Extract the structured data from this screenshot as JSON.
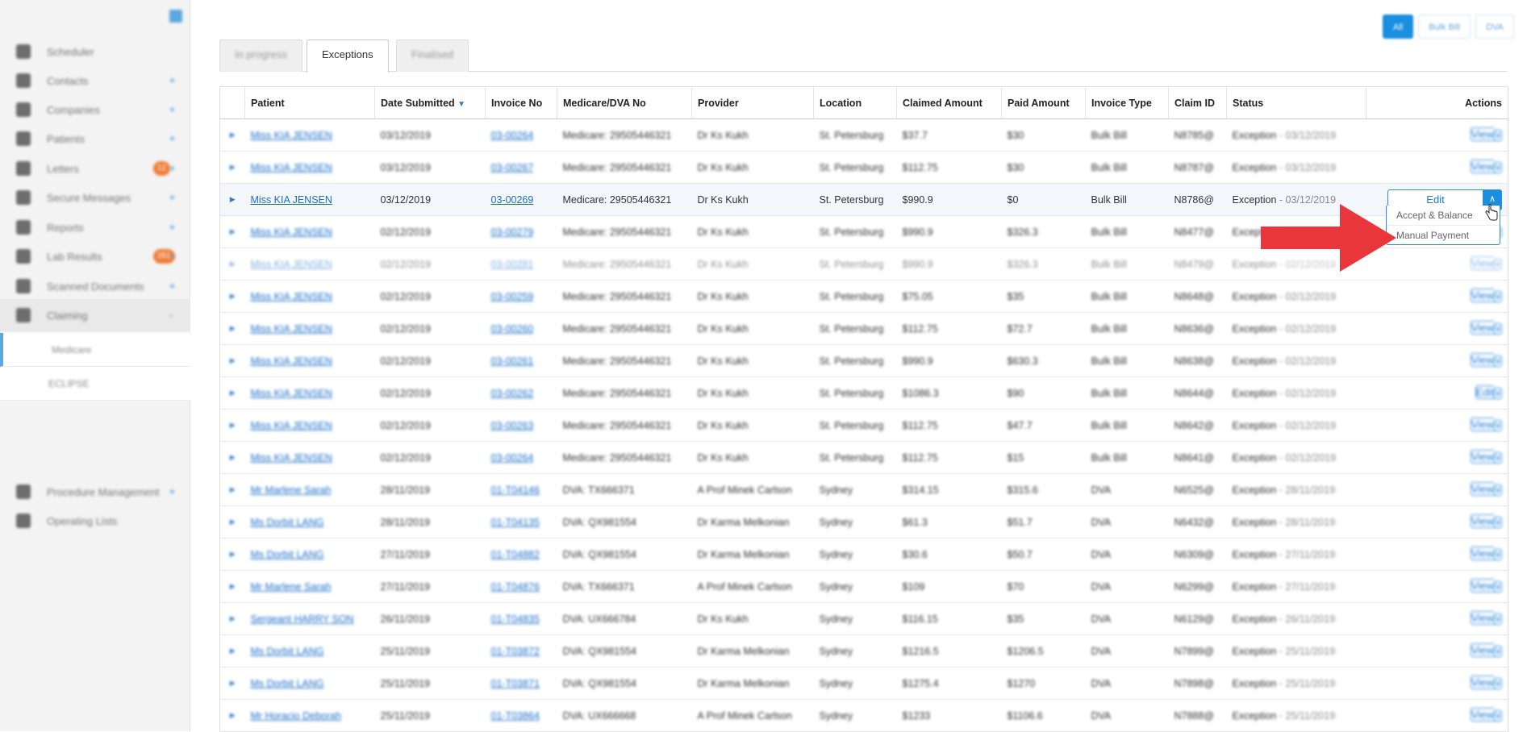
{
  "sidebar": {
    "items": [
      {
        "label": "Scheduler",
        "plus": ""
      },
      {
        "label": "Contacts",
        "plus": "+"
      },
      {
        "label": "Companies",
        "plus": "+"
      },
      {
        "label": "Patients",
        "plus": "+"
      },
      {
        "label": "Letters",
        "plus": "+",
        "badge": "12"
      },
      {
        "label": "Secure Messages",
        "plus": "+"
      },
      {
        "label": "Reports",
        "plus": "+"
      },
      {
        "label": "Lab Results",
        "plus": "+",
        "badge": "261"
      },
      {
        "label": "Scanned Documents",
        "plus": "+"
      },
      {
        "label": "Claiming",
        "plus": "-"
      },
      {
        "label": "Procedure Management",
        "plus": "+"
      },
      {
        "label": "Operating Lists",
        "plus": ""
      }
    ],
    "sub_items": [
      {
        "label": "Medicare"
      },
      {
        "label": "ECLIPSE"
      }
    ]
  },
  "top_buttons": [
    {
      "label": "All"
    },
    {
      "label": "Bulk Bill"
    },
    {
      "label": "DVA"
    }
  ],
  "tabs": [
    {
      "label": "In progress"
    },
    {
      "label": "Exceptions"
    },
    {
      "label": "Finalised"
    }
  ],
  "table": {
    "headers": {
      "patient": "Patient",
      "date_submitted": "Date Submitted",
      "sort_indicator": "▼",
      "invoice_no": "Invoice No",
      "medicare_dva_no": "Medicare/DVA No",
      "provider": "Provider",
      "location": "Location",
      "claimed_amount": "Claimed Amount",
      "paid_amount": "Paid Amount",
      "invoice_type": "Invoice Type",
      "claim_id": "Claim ID",
      "status": "Status",
      "actions": "Actions"
    },
    "rows": [
      {
        "patient": "Miss KIA JENSEN",
        "date": "03/12/2019",
        "invoice": "03-00264",
        "medicare": "Medicare: 29505446321",
        "provider": "Dr Ks Kukh",
        "location": "St. Petersburg",
        "claimed": "$37.7",
        "paid": "$30",
        "type": "Bulk Bill",
        "claim": "N8785@",
        "status": "Exception",
        "status_date": " - 03/12/2019",
        "action": "View"
      },
      {
        "patient": "Miss KIA JENSEN",
        "date": "03/12/2019",
        "invoice": "03-00267",
        "medicare": "Medicare: 29505446321",
        "provider": "Dr Ks Kukh",
        "location": "St. Petersburg",
        "claimed": "$112.75",
        "paid": "$30",
        "type": "Bulk Bill",
        "claim": "N8787@",
        "status": "Exception",
        "status_date": " - 03/12/2019",
        "action": "View"
      },
      {
        "patient": "Miss KIA JENSEN",
        "date": "03/12/2019",
        "invoice": "03-00269",
        "medicare": "Medicare: 29505446321",
        "provider": "Dr Ks Kukh",
        "location": "St. Petersburg",
        "claimed": "$990.9",
        "paid": "$0",
        "type": "Bulk Bill",
        "claim": "N8786@",
        "status": "Exception",
        "status_date": " - 03/12/2019",
        "action": "Edit"
      },
      {
        "patient": "Miss KIA JENSEN",
        "date": "02/12/2019",
        "invoice": "03-00279",
        "medicare": "Medicare: 29505446321",
        "provider": "Dr Ks Kukh",
        "location": "St. Petersburg",
        "claimed": "$990.9",
        "paid": "$326.3",
        "type": "Bulk Bill",
        "claim": "N8477@",
        "status": "Exception",
        "status_date": " - 02/12/2019",
        "action": "View"
      },
      {
        "patient": "Miss KIA JENSEN",
        "date": "02/12/2019",
        "invoice": "03-00281",
        "medicare": "Medicare: 29505446321",
        "provider": "Dr Ks Kukh",
        "location": "St. Petersburg",
        "claimed": "$990.9",
        "paid": "$326.3",
        "type": "Bulk Bill",
        "claim": "N8479@",
        "status": "Exception",
        "status_date": " - 02/12/2019",
        "action": "View"
      },
      {
        "patient": "Miss KIA JENSEN",
        "date": "02/12/2019",
        "invoice": "03-00259",
        "medicare": "Medicare: 29505446321",
        "provider": "Dr Ks Kukh",
        "location": "St. Petersburg",
        "claimed": "$75.05",
        "paid": "$35",
        "type": "Bulk Bill",
        "claim": "N8648@",
        "status": "Exception",
        "status_date": " - 02/12/2019",
        "action": "View"
      },
      {
        "patient": "Miss KIA JENSEN",
        "date": "02/12/2019",
        "invoice": "03-00260",
        "medicare": "Medicare: 29505446321",
        "provider": "Dr Ks Kukh",
        "location": "St. Petersburg",
        "claimed": "$112.75",
        "paid": "$72.7",
        "type": "Bulk Bill",
        "claim": "N8636@",
        "status": "Exception",
        "status_date": " - 02/12/2019",
        "action": "View"
      },
      {
        "patient": "Miss KIA JENSEN",
        "date": "02/12/2019",
        "invoice": "03-00261",
        "medicare": "Medicare: 29505446321",
        "provider": "Dr Ks Kukh",
        "location": "St. Petersburg",
        "claimed": "$990.9",
        "paid": "$630.3",
        "type": "Bulk Bill",
        "claim": "N8638@",
        "status": "Exception",
        "status_date": " - 02/12/2019",
        "action": "View"
      },
      {
        "patient": "Miss KIA JENSEN",
        "date": "02/12/2019",
        "invoice": "03-00262",
        "medicare": "Medicare: 29505446321",
        "provider": "Dr Ks Kukh",
        "location": "St. Petersburg",
        "claimed": "$1086.3",
        "paid": "$90",
        "type": "Bulk Bill",
        "claim": "N8644@",
        "status": "Exception",
        "status_date": " - 02/12/2019",
        "action": "Edit"
      },
      {
        "patient": "Miss KIA JENSEN",
        "date": "02/12/2019",
        "invoice": "03-00263",
        "medicare": "Medicare: 29505446321",
        "provider": "Dr Ks Kukh",
        "location": "St. Petersburg",
        "claimed": "$112.75",
        "paid": "$47.7",
        "type": "Bulk Bill",
        "claim": "N8642@",
        "status": "Exception",
        "status_date": " - 02/12/2019",
        "action": "View"
      },
      {
        "patient": "Miss KIA JENSEN",
        "date": "02/12/2019",
        "invoice": "03-00264",
        "medicare": "Medicare: 29505446321",
        "provider": "Dr Ks Kukh",
        "location": "St. Petersburg",
        "claimed": "$112.75",
        "paid": "$15",
        "type": "Bulk Bill",
        "claim": "N8641@",
        "status": "Exception",
        "status_date": " - 02/12/2019",
        "action": "View"
      },
      {
        "patient": "Mr Marlene Sarah",
        "date": "28/11/2019",
        "invoice": "01-T04146",
        "medicare": "DVA: TX666371",
        "provider": "A Prof Minek Carlson",
        "location": "Sydney",
        "claimed": "$314.15",
        "paid": "$315.6",
        "type": "DVA",
        "claim": "N6525@",
        "status": "Exception",
        "status_date": " - 28/11/2019",
        "action": "View"
      },
      {
        "patient": "Ms Dorbit LANG",
        "date": "28/11/2019",
        "invoice": "01-T04135",
        "medicare": "DVA: QX981554",
        "provider": "Dr Karma Melkonian",
        "location": "Sydney",
        "claimed": "$61.3",
        "paid": "$51.7",
        "type": "DVA",
        "claim": "N6432@",
        "status": "Exception",
        "status_date": " - 28/11/2019",
        "action": "View"
      },
      {
        "patient": "Ms Dorbit LANG",
        "date": "27/11/2019",
        "invoice": "01-T04882",
        "medicare": "DVA: QX981554",
        "provider": "Dr Karma Melkonian",
        "location": "Sydney",
        "claimed": "$30.6",
        "paid": "$50.7",
        "type": "DVA",
        "claim": "N6309@",
        "status": "Exception",
        "status_date": " - 27/11/2019",
        "action": "View"
      },
      {
        "patient": "Mr Marlene Sarah",
        "date": "27/11/2019",
        "invoice": "01-T04876",
        "medicare": "DVA: TX666371",
        "provider": "A Prof Minek Carlson",
        "location": "Sydney",
        "claimed": "$109",
        "paid": "$70",
        "type": "DVA",
        "claim": "N6299@",
        "status": "Exception",
        "status_date": " - 27/11/2019",
        "action": "View"
      },
      {
        "patient": "Sergeant HARRY SON",
        "date": "26/11/2019",
        "invoice": "01-T04835",
        "medicare": "DVA: UX666784",
        "provider": "Dr Ks Kukh",
        "location": "Sydney",
        "claimed": "$116.15",
        "paid": "$35",
        "type": "DVA",
        "claim": "N6129@",
        "status": "Exception",
        "status_date": " - 26/11/2019",
        "action": "View"
      },
      {
        "patient": "Ms Dorbit LANG",
        "date": "25/11/2019",
        "invoice": "01-T03872",
        "medicare": "DVA: QX981554",
        "provider": "Dr Karma Melkonian",
        "location": "Sydney",
        "claimed": "$1216.5",
        "paid": "$1206.5",
        "type": "DVA",
        "claim": "N7899@",
        "status": "Exception",
        "status_date": " - 25/11/2019",
        "action": "View"
      },
      {
        "patient": "Ms Dorbit LANG",
        "date": "25/11/2019",
        "invoice": "01-T03871",
        "medicare": "DVA: QX981554",
        "provider": "Dr Karma Melkonian",
        "location": "Sydney",
        "claimed": "$1275.4",
        "paid": "$1270",
        "type": "DVA",
        "claim": "N7898@",
        "status": "Exception",
        "status_date": " - 25/11/2019",
        "action": "View"
      },
      {
        "patient": "Mr Horacio Deborah",
        "date": "25/11/2019",
        "invoice": "01-T03864",
        "medicare": "DVA: UX666668",
        "provider": "A Prof Minek Carlson",
        "location": "Sydney",
        "claimed": "$1233",
        "paid": "$1106.6",
        "type": "DVA",
        "claim": "N7888@",
        "status": "Exception",
        "status_date": " - 25/11/2019",
        "action": "View"
      }
    ]
  },
  "dropdown": {
    "items": [
      {
        "label": "Accept & Balance"
      },
      {
        "label": "Manual Payment"
      }
    ]
  },
  "colors": {
    "primary": "#1a8fe0",
    "link": "#1a6ec7",
    "arrow": "#e8363a",
    "badge": "#f07d3a"
  }
}
